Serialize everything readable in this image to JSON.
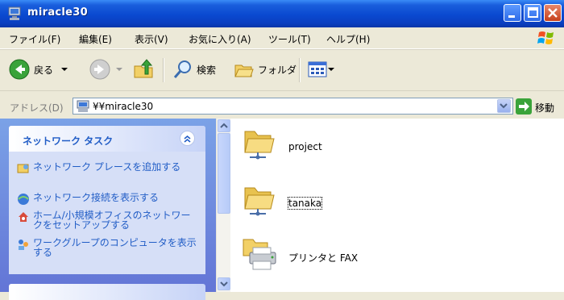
{
  "window": {
    "title": "miracle30"
  },
  "menu": [
    "ファイル(F)",
    "編集(E)",
    "表示(V)",
    "お気に入り(A)",
    "ツール(T)",
    "ヘルプ(H)"
  ],
  "toolbar": {
    "back_label": "戻る",
    "search_label": "検索",
    "folders_label": "フォルダ"
  },
  "address": {
    "label": "アドレス(D)",
    "value": "¥¥miracle30",
    "go_label": "移動"
  },
  "taskpane": {
    "title": "ネットワーク タスク",
    "tasks": [
      "ネットワーク プレースを追加する",
      "ネットワーク接続を表示する",
      "ホーム/小規模オフィスのネットワークをセットアップする",
      "ワークグループのコンピュータを表示する"
    ]
  },
  "files": [
    {
      "name": "project",
      "type": "shared-folder"
    },
    {
      "name": "tanaka",
      "type": "shared-folder"
    },
    {
      "name": "プリンタと FAX",
      "type": "printers-faxes"
    }
  ],
  "colors": {
    "titlebar": "#0a49d0",
    "taskpane_bg": "#6375d6",
    "task_link": "#215dc6"
  }
}
